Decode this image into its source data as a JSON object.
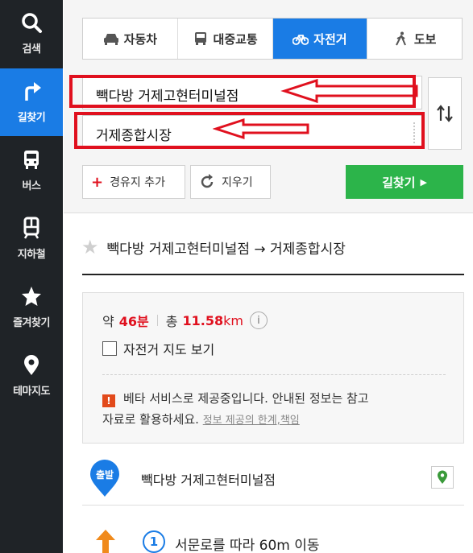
{
  "sidebar": {
    "items": [
      {
        "label": "검색",
        "icon": "search-icon"
      },
      {
        "label": "길찾기",
        "icon": "directions-icon"
      },
      {
        "label": "버스",
        "icon": "bus-icon"
      },
      {
        "label": "지하철",
        "icon": "subway-icon"
      },
      {
        "label": "즐겨찾기",
        "icon": "star-icon"
      },
      {
        "label": "테마지도",
        "icon": "map-pin-icon"
      }
    ],
    "active": 1
  },
  "tabs": [
    {
      "label": "자동차",
      "icon": "car-icon"
    },
    {
      "label": "대중교통",
      "icon": "transit-icon"
    },
    {
      "label": "자전거",
      "icon": "bicycle-icon"
    },
    {
      "label": "도보",
      "icon": "walk-icon"
    }
  ],
  "active_tab": 2,
  "origin": {
    "value": "빽다방 거제고현터미널점"
  },
  "destination": {
    "value": "거제종합시장"
  },
  "actions": {
    "add_waypoint": "경유지 추가",
    "clear": "지우기",
    "search": "길찾기"
  },
  "route": {
    "title": "빽다방 거제고현터미널점 → 거제종합시장",
    "time_prefix": "약",
    "time_value": "46분",
    "distance_prefix": "총",
    "distance_value": "11.58",
    "distance_unit": "km",
    "bike_map_label": "자전거 지도 보기",
    "notice_line1": "베타 서비스로 제공중입니다. 안내된 정보는 참고",
    "notice_line2": "자료로 활용하세요.",
    "notice_link": "정보 제공의 한계,책임",
    "start_badge": "출발",
    "start_name": "빽다방 거제고현터미널점",
    "step1_num": "1",
    "step1_text": "서문로를 따라 60m 이동"
  },
  "colors": {
    "accent": "#1a7ce5",
    "go": "#2cb44a",
    "highlight": "#e0101e",
    "rail": "#1f2327"
  }
}
